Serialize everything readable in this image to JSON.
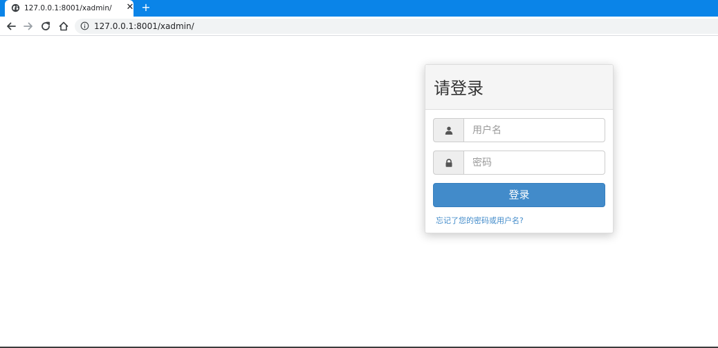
{
  "browser": {
    "tab": {
      "title": "127.0.0.1:8001/xadmin/",
      "close_glyph": "✕",
      "favicon": "globe-icon"
    },
    "new_tab_glyph": "+",
    "toolbar": {
      "icons": [
        "back-arrow-icon",
        "forward-arrow-icon",
        "reload-icon",
        "home-icon",
        "info-icon"
      ]
    },
    "url": "127.0.0.1:8001/xadmin/",
    "colors": {
      "tabbar": "#0a84e8",
      "omnibox": "#f1f3f4"
    }
  },
  "login": {
    "title": "请登录",
    "username": {
      "placeholder": "用户名",
      "value": "",
      "icon": "user-icon"
    },
    "password": {
      "placeholder": "密码",
      "value": "",
      "icon": "lock-icon"
    },
    "submit_label": "登录",
    "forgot_link": "忘记了您的密码或用户名?",
    "colors": {
      "primary": "#428bca",
      "link": "#428bca",
      "heading_bg": "#f5f5f5"
    }
  }
}
